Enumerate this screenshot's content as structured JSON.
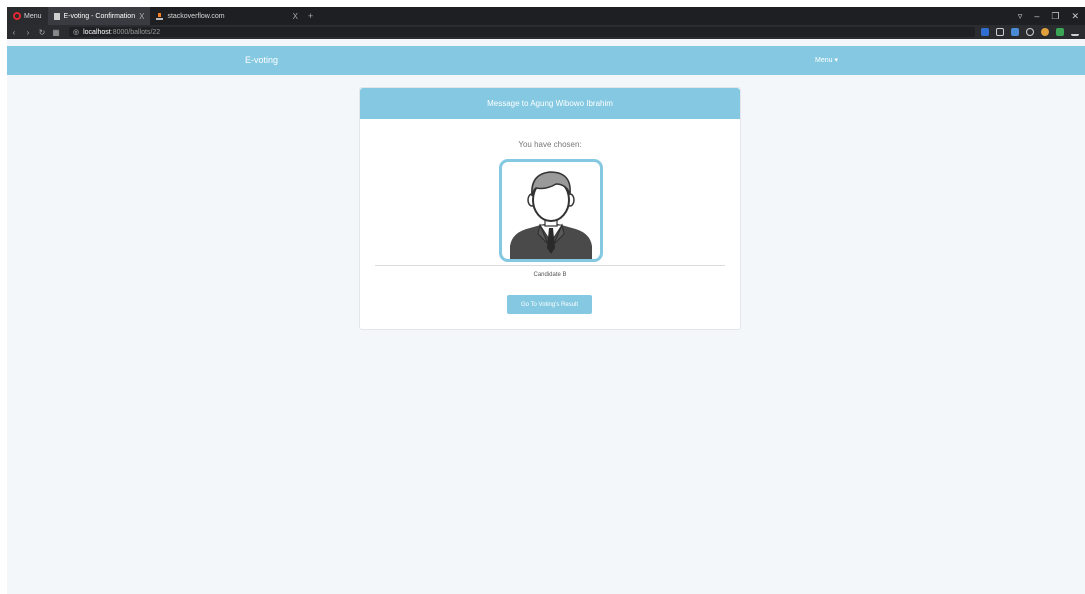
{
  "browser": {
    "menu_label": "Menu",
    "tabs": [
      {
        "title": "E-voting - Confirmation",
        "close": "X"
      },
      {
        "title": "stackoverflow.com",
        "close": "X"
      }
    ],
    "new_tab": "+",
    "url_host": "localhost",
    "url_path": ":8000/ballots/22",
    "colors": {
      "opera_red": "#e0282e",
      "chrome_bg": "#1e1f22"
    }
  },
  "navbar": {
    "brand": "E-voting",
    "menu": "Menu ▾",
    "color": "#84c9e1"
  },
  "card": {
    "header": "Message to Agung Wibowo Ibrahim",
    "chosen_text": "You have chosen:",
    "candidate_name": "Candidate B",
    "button_label": "Go To Voting's Result"
  }
}
